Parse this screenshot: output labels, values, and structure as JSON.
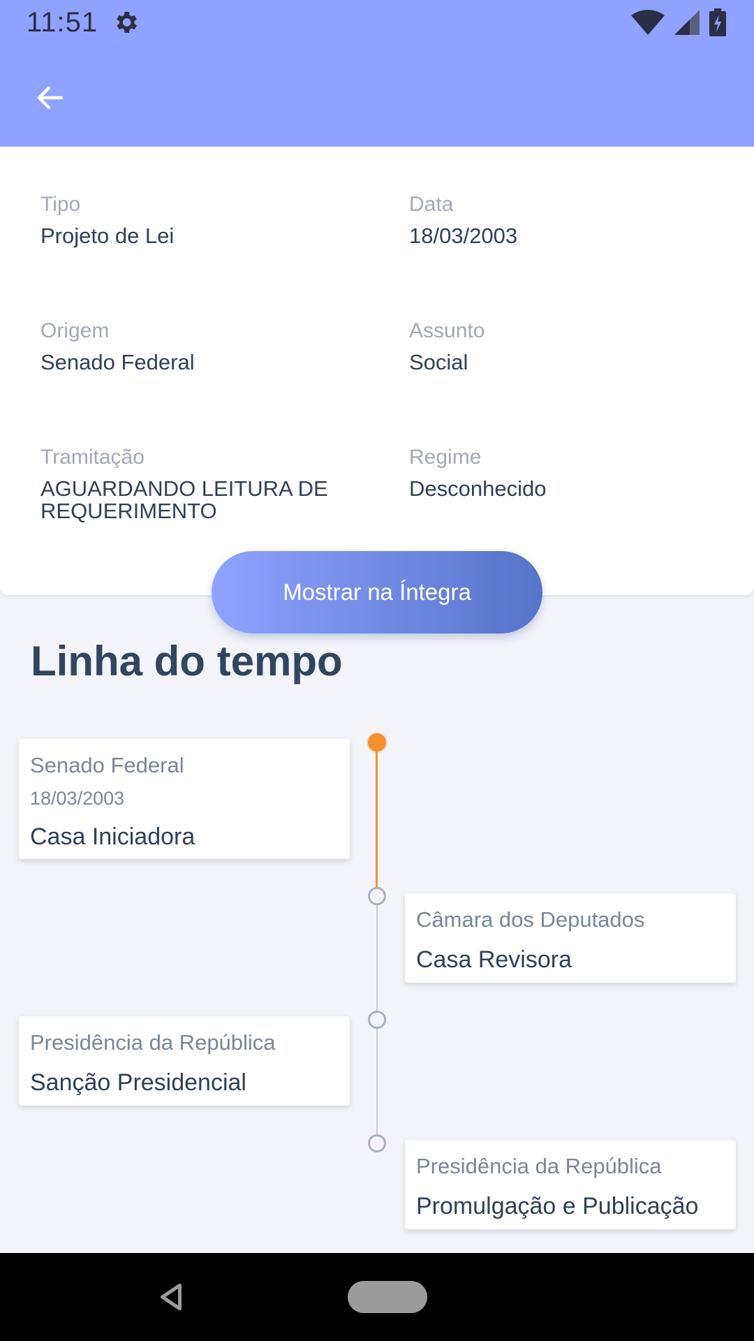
{
  "status_bar": {
    "time": "11:51",
    "icons": [
      "gear-icon",
      "wifi-icon",
      "signal-icon",
      "battery-icon"
    ]
  },
  "app_bar": {
    "back_icon": "arrow-left-icon"
  },
  "details": {
    "tipo": {
      "label": "Tipo",
      "value": "Projeto de Lei"
    },
    "data": {
      "label": "Data",
      "value": "18/03/2003"
    },
    "origem": {
      "label": "Origem",
      "value": "Senado Federal"
    },
    "assunto": {
      "label": "Assunto",
      "value": "Social"
    },
    "tramitacao": {
      "label": "Tramitação",
      "value_line1": "AGUARDANDO LEITURA DE",
      "value_line2": "REQUERIMENTO"
    },
    "regime": {
      "label": "Regime",
      "value": "Desconhecido"
    }
  },
  "cta": {
    "label": "Mostrar na Íntegra"
  },
  "timeline": {
    "title": "Linha do tempo",
    "events": [
      {
        "org": "Senado Federal",
        "date": "18/03/2003",
        "stage": "Casa Iniciadora",
        "active": true
      },
      {
        "org": "Câmara dos Deputados",
        "stage": "Casa Revisora",
        "active": false
      },
      {
        "org": "Presidência da República",
        "stage": "Sanção Presidencial",
        "active": false
      },
      {
        "org": "Presidência da República",
        "stage": "Promulgação e Publicação",
        "active": false
      }
    ]
  },
  "colors": {
    "primary": "#8fa2ff",
    "gradient_end": "#5574ca",
    "timeline_active": "#f5902e",
    "timeline_inactive": "#b8c0cc",
    "background": "#f2f4f9"
  },
  "nav_bar": {
    "icons": [
      "nav-back-icon",
      "nav-home-pill"
    ]
  }
}
